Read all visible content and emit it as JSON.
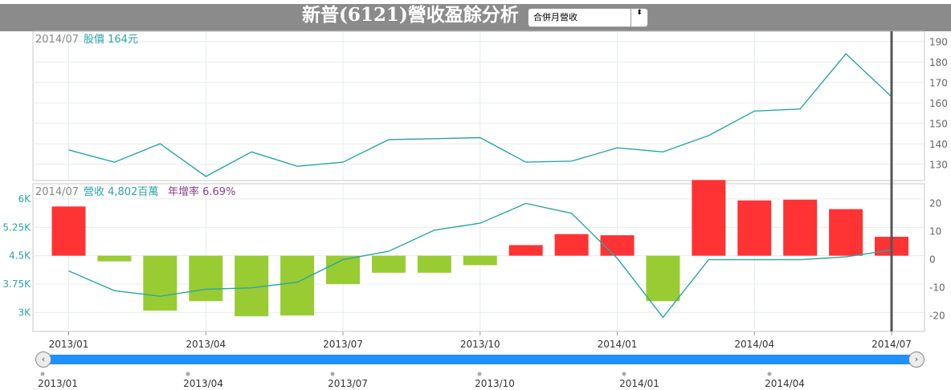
{
  "header": {
    "title": "新普(6121)營收盈餘分析",
    "select_value": "合併月營收",
    "select_arrow": "⬍"
  },
  "colors": {
    "price_line": "#2aa6a6",
    "positive_bar": "#ff3333",
    "negative_bar": "#99cc33",
    "label_teal": "#2aa6a6",
    "label_purple": "#8a3d8a",
    "grid": "#e4ecec"
  },
  "top_panel": {
    "date": "2014/07",
    "label": "股價 164元"
  },
  "bottom_panel": {
    "date": "2014/07",
    "label": "營收 4,802百萬",
    "yoy_label": "年增率 6.69%"
  },
  "chart_data": [
    {
      "type": "line",
      "name": "stock_price",
      "x": [
        "2013/01",
        "2013/02",
        "2013/03",
        "2013/04",
        "2013/05",
        "2013/06",
        "2013/07",
        "2013/08",
        "2013/09",
        "2013/10",
        "2013/11",
        "2013/12",
        "2014/01",
        "2014/02",
        "2014/03",
        "2014/04",
        "2014/05",
        "2014/06",
        "2014/07"
      ],
      "values": [
        137,
        131,
        140,
        124,
        136,
        129,
        131,
        142,
        142.5,
        143,
        131,
        131.5,
        138,
        136,
        144,
        156,
        157,
        184,
        163
      ],
      "ylim": [
        122,
        195
      ],
      "yticks": [
        130,
        140,
        150,
        160,
        170,
        180,
        190
      ]
    },
    {
      "type": "bar",
      "name": "revenue",
      "x": [
        "2013/01",
        "2013/02",
        "2013/03",
        "2013/04",
        "2013/05",
        "2013/06",
        "2013/07",
        "2013/08",
        "2013/09",
        "2013/10",
        "2013/11",
        "2013/12",
        "2014/01",
        "2014/02",
        "2014/03",
        "2014/04",
        "2014/05",
        "2014/06",
        "2014/07"
      ],
      "values": [
        5.8,
        4.35,
        3.05,
        3.3,
        2.9,
        2.92,
        3.75,
        4.05,
        4.05,
        4.25,
        4.78,
        5.07,
        5.04,
        3.3,
        6.5,
        5.96,
        5.98,
        5.73,
        5.0
      ],
      "baseline": 4.5,
      "ylim": [
        2.5,
        6.4
      ],
      "yticks": [
        "3K",
        "3.75K",
        "4.5K",
        "5.25K",
        "6K"
      ],
      "ytick_values": [
        3,
        3.75,
        4.5,
        5.25,
        6
      ]
    },
    {
      "type": "line",
      "name": "yoy",
      "x": [
        "2013/01",
        "2013/02",
        "2013/03",
        "2013/04",
        "2013/05",
        "2013/06",
        "2013/07",
        "2013/08",
        "2013/09",
        "2013/10",
        "2013/11",
        "2013/12",
        "2014/01",
        "2014/02",
        "2014/03",
        "2014/04",
        "2014/05",
        "2014/06",
        "2014/07"
      ],
      "values": [
        -4,
        -11,
        -13,
        -10.5,
        -10,
        -8,
        0,
        3,
        10.5,
        13,
        20,
        16.5,
        0.5,
        -20.5,
        0,
        0,
        0,
        1,
        3.5
      ],
      "ylim": [
        -25.5,
        27
      ],
      "yticks": [
        -20,
        -10,
        0,
        10,
        20
      ]
    }
  ],
  "x_axis_labels": [
    "2013/01",
    "2013/04",
    "2013/07",
    "2013/10",
    "2014/01",
    "2014/04",
    "2014/07"
  ],
  "navigator": {
    "labels": [
      "2013/01",
      "2013/04",
      "2013/07",
      "2013/10",
      "2014/01",
      "2014/04"
    ],
    "left_button": "‹",
    "right_button": "›"
  }
}
